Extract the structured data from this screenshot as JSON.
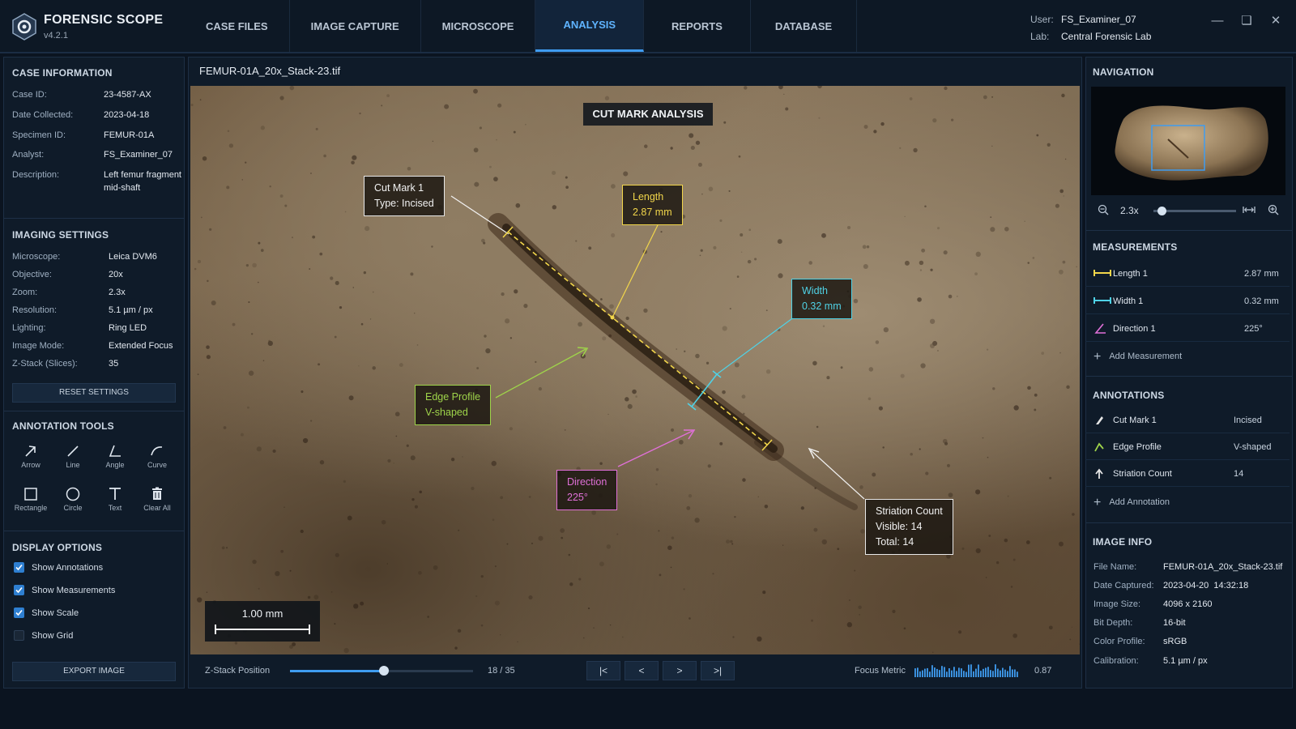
{
  "app": {
    "name": "FORENSIC SCOPE",
    "version": "v4.2.1"
  },
  "nav": {
    "tabs": [
      "CASE FILES",
      "IMAGE CAPTURE",
      "MICROSCOPE",
      "ANALYSIS",
      "REPORTS",
      "DATABASE"
    ],
    "active": "ANALYSIS"
  },
  "user": {
    "user_label": "User:",
    "user_value": "FS_Examiner_07",
    "lab_label": "Lab:",
    "lab_value": "Central Forensic Lab"
  },
  "case_info": {
    "title": "CASE INFORMATION",
    "fields": [
      {
        "label": "Case ID:",
        "value": "23-4587-AX"
      },
      {
        "label": "Date Collected:",
        "value": "2023-04-18"
      },
      {
        "label": "Specimen ID:",
        "value": "FEMUR-01A"
      },
      {
        "label": "Analyst:",
        "value": "FS_Examiner_07"
      },
      {
        "label": "Description:",
        "value": "Left femur fragment",
        "value2": "mid-shaft"
      }
    ]
  },
  "imaging": {
    "title": "IMAGING SETTINGS",
    "fields": [
      {
        "label": "Microscope:",
        "value": "Leica DVM6"
      },
      {
        "label": "Objective:",
        "value": "20x"
      },
      {
        "label": "Zoom:",
        "value": "2.3x"
      },
      {
        "label": "Resolution:",
        "value": "5.1 µm / px"
      },
      {
        "label": "Lighting:",
        "value": "Ring LED"
      },
      {
        "label": "Image Mode:",
        "value": "Extended Focus"
      },
      {
        "label": "Z-Stack (Slices):",
        "value": "35"
      }
    ],
    "reset_label": "RESET SETTINGS"
  },
  "tools": {
    "title": "ANNOTATION TOOLS",
    "items": [
      "Arrow",
      "Line",
      "Angle",
      "Curve",
      "Rectangle",
      "Circle",
      "Text",
      "Clear All"
    ]
  },
  "display": {
    "title": "DISPLAY OPTIONS",
    "options": [
      {
        "label": "Show Annotations",
        "checked": true
      },
      {
        "label": "Show Measurements",
        "checked": true
      },
      {
        "label": "Show Scale",
        "checked": true
      },
      {
        "label": "Show Grid",
        "checked": false
      }
    ],
    "export_label": "EXPORT IMAGE"
  },
  "viewer": {
    "filename": "FEMUR-01A_20x_Stack-23.tif",
    "overlay_title": "CUT MARK ANALYSIS",
    "labels": {
      "cut_mark": [
        "Cut Mark 1",
        "Type: Incised"
      ],
      "length": [
        "Length",
        "2.87 mm"
      ],
      "width": [
        "Width",
        "0.32 mm"
      ],
      "edge": [
        "Edge Profile",
        "V-shaped"
      ],
      "direction": [
        "Direction",
        "225°"
      ],
      "striation": [
        "Striation Count",
        "Visible: 14",
        "Total: 14"
      ]
    },
    "scale_bar": "1.00 mm",
    "colors": {
      "yellow": "#f2d64b",
      "cyan": "#4fd2e6",
      "green": "#9fd44a",
      "magenta": "#e070d8",
      "white": "#f2f2f2"
    }
  },
  "zstack": {
    "label": "Z-Stack Position",
    "position": "18 / 35",
    "fraction": 0.514,
    "focus_label": "Focus Metric",
    "focus_value": "0.87",
    "buttons": [
      "|<",
      "<",
      ">",
      ">|"
    ]
  },
  "navigation": {
    "title": "NAVIGATION",
    "zoom": "2.3x",
    "zoom_fraction": 0.1
  },
  "measurements": {
    "title": "MEASUREMENTS",
    "items": [
      {
        "name": "Length 1",
        "value": "2.87 mm",
        "color": "#f2d64b"
      },
      {
        "name": "Width 1",
        "value": "0.32 mm",
        "color": "#4fd2e6"
      },
      {
        "name": "Direction 1",
        "value": "225°",
        "color": "#e070d8"
      }
    ],
    "add_label": "Add Measurement"
  },
  "annotations": {
    "title": "ANNOTATIONS",
    "items": [
      {
        "name": "Cut Mark 1",
        "value": "Incised"
      },
      {
        "name": "Edge Profile",
        "value": "V-shaped"
      },
      {
        "name": "Striation Count",
        "value": "14"
      }
    ],
    "add_label": "Add Annotation"
  },
  "image_info": {
    "title": "IMAGE INFO",
    "fields": [
      {
        "label": "File Name:",
        "value": "FEMUR-01A_20x_Stack-23.tif"
      },
      {
        "label": "Date Captured:",
        "value": "2023-04-20  14:32:18"
      },
      {
        "label": "Image Size:",
        "value": "4096 x 2160"
      },
      {
        "label": "Bit Depth:",
        "value": "16-bit"
      },
      {
        "label": "Color Profile:",
        "value": "sRGB"
      },
      {
        "label": "Calibration:",
        "value": "5.1 µm / px"
      }
    ]
  }
}
